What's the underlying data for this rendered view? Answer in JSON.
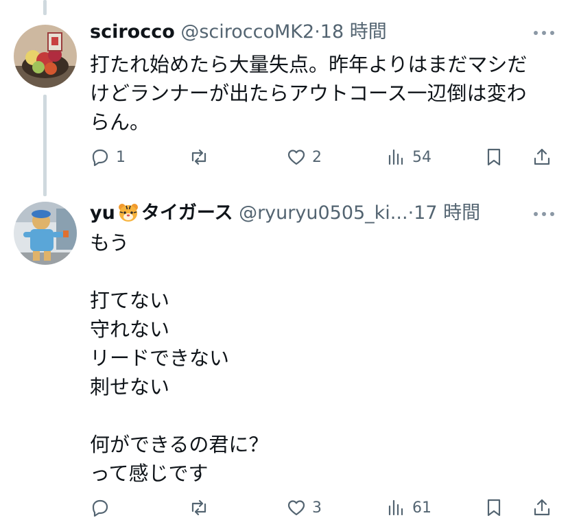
{
  "posts": [
    {
      "name": "scirocco",
      "handle": "@sciroccoMK2",
      "dot": "·",
      "time": "18 時間",
      "lines": [
        "打たれ始めたら大量失点。昨年よりはまだマシだ",
        "けどランナーが出たらアウトコース一辺倒は変わ",
        "らん。"
      ],
      "actions": {
        "reply": "1",
        "repost": "",
        "like": "2",
        "views": "54"
      },
      "avatar_icon": "fruit-basket-avatar"
    },
    {
      "name_prefix": "yu",
      "name_emoji": "tiger-face",
      "name_suffix": "タイガース",
      "handle": "@ryuryu0505_ki...",
      "dot": "·",
      "time": "17 時間",
      "lines": [
        "もう",
        "",
        "打てない",
        "守れない",
        "リードできない",
        "刺せない",
        "",
        "何ができるの君に？",
        "って感じです"
      ],
      "actions": {
        "reply": "",
        "repost": "",
        "like": "3",
        "views": "61"
      },
      "avatar_icon": "mascot-avatar"
    }
  ],
  "colors": {
    "text": "#0f1419",
    "secondary": "#536471",
    "thread_line": "#cfd9de",
    "background": "#ffffff"
  }
}
